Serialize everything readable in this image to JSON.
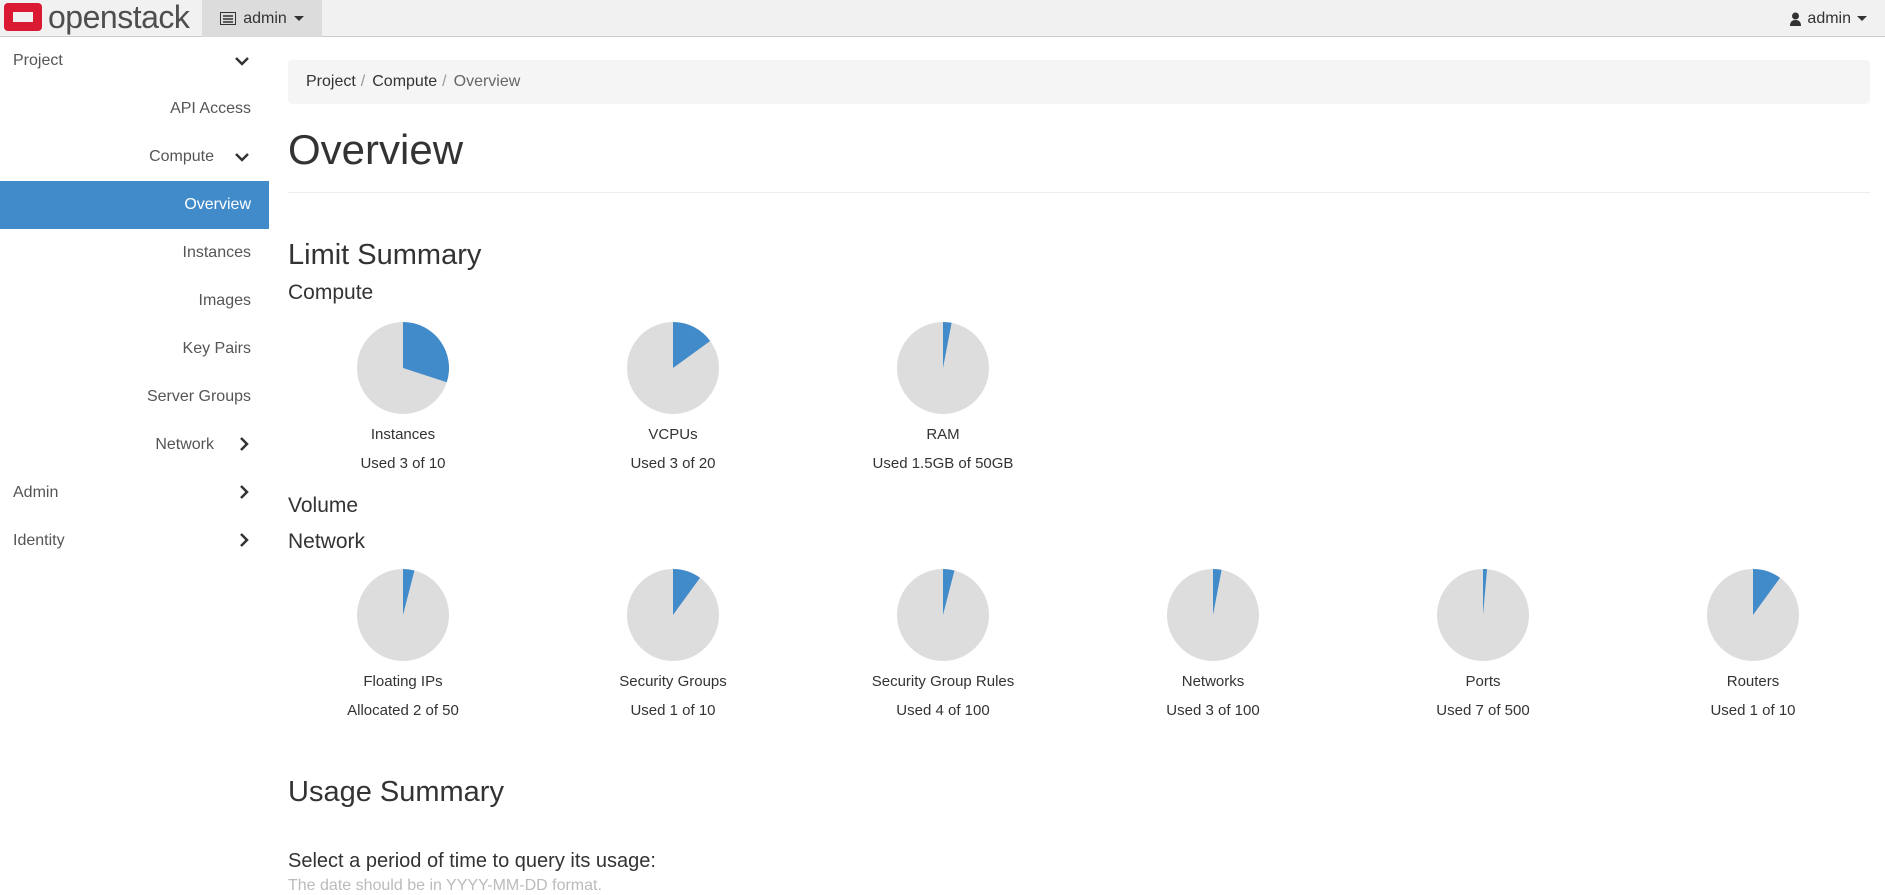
{
  "topbar": {
    "logo": "openstack",
    "project": "admin",
    "user": "admin"
  },
  "sidebar": {
    "items": [
      {
        "label": "Project",
        "level": "l0",
        "chev": "⌄"
      },
      {
        "label": "API Access",
        "level": "r"
      },
      {
        "label": "Compute",
        "level": "l1",
        "chev": "⌄"
      },
      {
        "label": "Overview",
        "level": "r",
        "active": true
      },
      {
        "label": "Instances",
        "level": "r"
      },
      {
        "label": "Images",
        "level": "r"
      },
      {
        "label": "Key Pairs",
        "level": "r"
      },
      {
        "label": "Server Groups",
        "level": "r"
      },
      {
        "label": "Network",
        "level": "l1",
        "chev": "›"
      },
      {
        "label": "Admin",
        "level": "l0",
        "chev": "›"
      },
      {
        "label": "Identity",
        "level": "l0",
        "chev": "›"
      }
    ]
  },
  "breadcrumb": [
    "Project",
    "Compute",
    "Overview"
  ],
  "title": "Overview",
  "limit_summary": "Limit Summary",
  "compute": {
    "heading": "Compute",
    "pies": [
      {
        "label": "Instances",
        "used_text": "Used 3 of 10",
        "used": 3,
        "total": 10
      },
      {
        "label": "VCPUs",
        "used_text": "Used 3 of 20",
        "used": 3,
        "total": 20
      },
      {
        "label": "RAM",
        "used_text": "Used 1.5GB of 50GB",
        "used": 1.5,
        "total": 50
      }
    ]
  },
  "volume": {
    "heading": "Volume"
  },
  "network": {
    "heading": "Network",
    "pies": [
      {
        "label": "Floating IPs",
        "used_text": "Allocated 2 of 50",
        "used": 2,
        "total": 50
      },
      {
        "label": "Security Groups",
        "used_text": "Used 1 of 10",
        "used": 1,
        "total": 10
      },
      {
        "label": "Security Group Rules",
        "used_text": "Used 4 of 100",
        "used": 4,
        "total": 100
      },
      {
        "label": "Networks",
        "used_text": "Used 3 of 100",
        "used": 3,
        "total": 100
      },
      {
        "label": "Ports",
        "used_text": "Used 7 of 500",
        "used": 7,
        "total": 500
      },
      {
        "label": "Routers",
        "used_text": "Used 1 of 10",
        "used": 1,
        "total": 10
      }
    ]
  },
  "usage_summary": "Usage Summary",
  "usage_prompt": "Select a period of time to query its usage:",
  "usage_help": "The date should be in YYYY-MM-DD format.",
  "colors": {
    "used": "#428bca",
    "free": "#dddddd",
    "active": "#428bca"
  }
}
